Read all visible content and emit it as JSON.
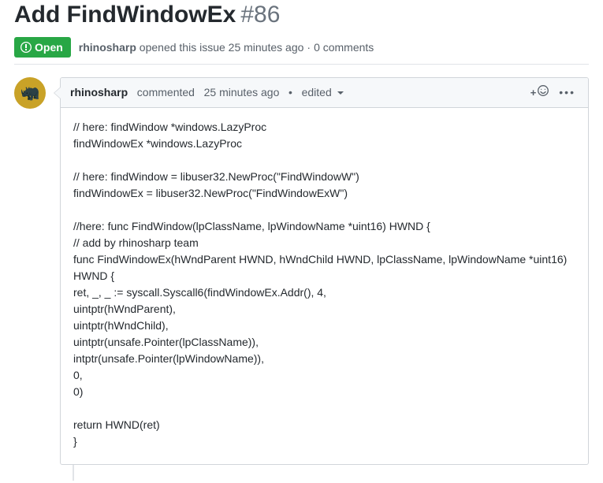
{
  "issue": {
    "title": "Add FindWindowEx",
    "number": "#86",
    "state": "Open",
    "author": "rhinosharp",
    "opened_text": "opened this issue",
    "opened_ago": "25 minutes ago",
    "comments_text": "0 comments"
  },
  "comment": {
    "author": "rhinosharp",
    "action": "commented",
    "time": "25 minutes ago",
    "edited": "edited",
    "bullet": "•",
    "body": "// here: findWindow *windows.LazyProc\nfindWindowEx *windows.LazyProc\n\n// here: findWindow = libuser32.NewProc(\"FindWindowW\")\nfindWindowEx = libuser32.NewProc(\"FindWindowExW\")\n\n//here: func FindWindow(lpClassName, lpWindowName *uint16) HWND {\n// add by rhinosharp team\nfunc FindWindowEx(hWndParent HWND, hWndChild HWND, lpClassName, lpWindowName *uint16) HWND {\nret, _, _ := syscall.Syscall6(findWindowEx.Addr(), 4,\nuintptr(hWndParent),\nuintptr(hWndChild),\nuintptr(unsafe.Pointer(lpClassName)),\nintptr(unsafe.Pointer(lpWindowName)),\n0,\n0)\n\nreturn HWND(ret)\n}",
    "reaction_plus": "+"
  }
}
